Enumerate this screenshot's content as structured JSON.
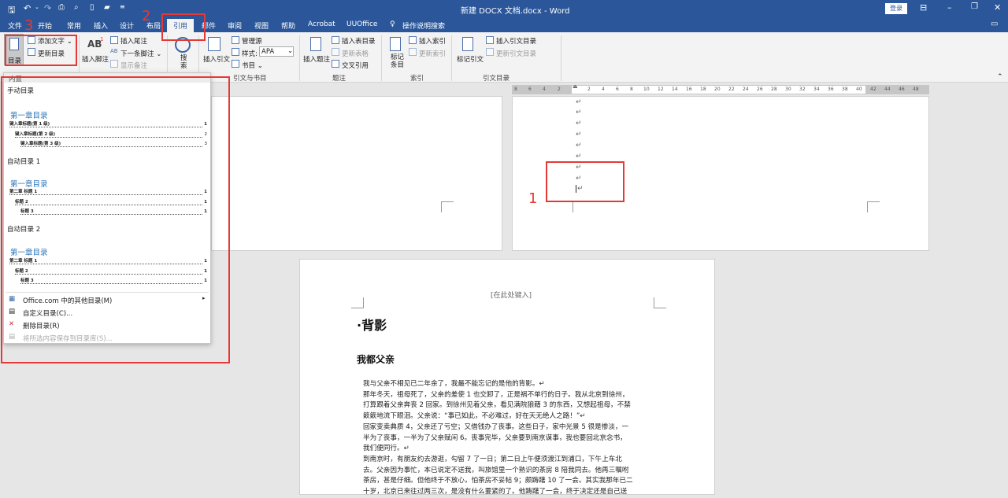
{
  "titlebar": {
    "title": "新建 DOCX 文档.docx  -  Word",
    "login": "登录"
  },
  "tabs": [
    "文件",
    "开始",
    "常用",
    "插入",
    "设计",
    "布局",
    "引用",
    "邮件",
    "审阅",
    "视图",
    "帮助",
    "Acrobat",
    "UUOffice",
    "操作说明搜索"
  ],
  "ribbon": {
    "toc": {
      "label": "目录",
      "add_text": "添加文字 ⌄",
      "update": "更新目录"
    },
    "footnotes": {
      "insert_footnote_label": "插入脚注",
      "ab_mark": "AB",
      "insert_endnote": "插入尾注",
      "next_footnote": "下一条脚注  ⌄",
      "show_notes": "显示备注"
    },
    "search": {
      "label": "搜\n索"
    },
    "citations": {
      "insert_citation": "插入引文",
      "manage_sources": "管理源",
      "style_label": "样式:",
      "style_value": "APA",
      "bibliography": "书目 ⌄"
    },
    "captions": {
      "insert_caption": "插入题注",
      "insert_table_of_figures": "插入表目录",
      "update_table": "更新表格",
      "cross_reference": "交叉引用"
    },
    "index": {
      "mark_entry": "标记\n条目",
      "insert_index": "插入索引",
      "update_index": "更新索引"
    },
    "authorities": {
      "mark_citation": "标记引文",
      "insert_table_of_authorities": "插入引文目录",
      "update_table": "更新引文目录"
    },
    "group_labels": {
      "toc": "目录",
      "footnotes": "脚注",
      "citations": "引文与书目",
      "captions": "题注",
      "index": "索引",
      "authorities": "引文目录"
    }
  },
  "toc_dropdown": {
    "header": "内置",
    "sections": [
      {
        "name": "手动目录",
        "title": "第一章目录",
        "entries": [
          {
            "text": "键入章标题(第 1 级)",
            "page": "1"
          },
          {
            "text": "键入章标题(第 2 级)",
            "page": "2"
          },
          {
            "text": "键入章标题(第 3 级)",
            "page": "3"
          }
        ]
      },
      {
        "name": "自动目录 1",
        "title": "第一章目录",
        "entries": [
          {
            "text": "第二章  标题 1",
            "page": "1"
          },
          {
            "text": "标题 2",
            "page": "1"
          },
          {
            "text": "标题 3",
            "page": "1"
          }
        ]
      },
      {
        "name": "自动目录 2",
        "title": "第一章目录",
        "entries": [
          {
            "text": "第二章  标题 1",
            "page": "1"
          },
          {
            "text": "标题 2",
            "page": "1"
          },
          {
            "text": "标题 3",
            "page": "1"
          }
        ]
      }
    ],
    "menu": [
      {
        "label": "Office.com 中的其他目录(M)",
        "arrow": "▸"
      },
      {
        "label": "自定义目录(C)..."
      },
      {
        "label": "删除目录(R)"
      },
      {
        "label": "将所选内容保存到目录库(S)..."
      }
    ]
  },
  "ruler": {
    "ticks": [
      "8",
      "6",
      "4",
      "2",
      "",
      "2",
      "4",
      "6",
      "8",
      "10",
      "12",
      "14",
      "16",
      "18",
      "20",
      "22",
      "24",
      "26",
      "28",
      "30",
      "32",
      "34",
      "36",
      "38",
      "40",
      "42",
      "44",
      "46",
      "48"
    ]
  },
  "document": {
    "header_placeholder": "[在此处键入]",
    "heading1": "·背影",
    "heading2": "我都父亲",
    "para_mark": "↵",
    "lines": [
      "我与父亲不相见已二年余了，我最不能忘记的是他的背影。↵",
      "那年冬天，祖母死了，父亲的差使 1 也交卸了，正是祸不单行的日子。我从北京到徐州，",
      "打算跟着父亲奔丧 2 回家。到徐州见着父亲，看见满院狼藉 3 的东西，又想起祖母，不禁",
      "簌簌地流下眼泪。父亲说：“事已如此，不必难过，好在天无绝人之路！”↵",
      "回家变卖典质 4，父亲还了亏空；又借钱办了丧事。这些日子，家中光景 5 很是惨淡，一",
      "半为了丧事，一半为了父亲赋闲 6。丧事完毕，父亲要到南京谋事，我也要回北京念书，",
      "我们便同行。↵",
      "到南京时，有朋友约去游逛，勾留 7 了一日；第二日上午便须渡江到浦口，下午上车北",
      "去。父亲因为事忙，本已说定不送我，叫旅馆里一个熟识的茶房 8 陪我同去。他再三嘱咐",
      "茶房，甚是仔细。但他终于不放心，怕茶房不妥帖 9；颇踌躇 10 了一会。其实我那年已二",
      "十岁，北京已来往过两三次，是没有什么要紧的了。他踌躇了一会，终于决定还是自己送"
    ]
  },
  "annotations": [
    "1",
    "2",
    "3"
  ]
}
